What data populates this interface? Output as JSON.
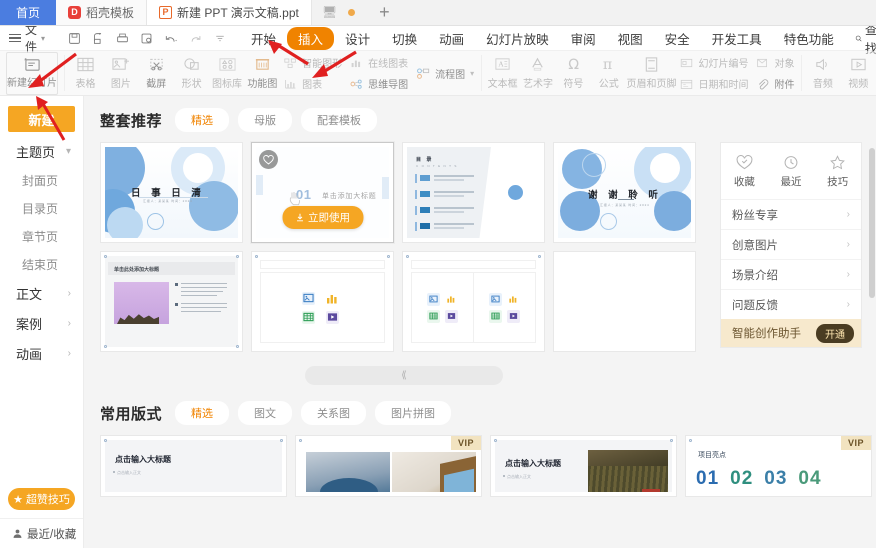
{
  "tabbar": {
    "home_label": "首页",
    "tabs": [
      {
        "label": "稻壳模板",
        "icon": "dock-icon",
        "active": false
      },
      {
        "label": "新建 PPT 演示文稿.ppt",
        "icon": "ppt-file-icon",
        "active": true
      }
    ],
    "monitor_icon": "monitor-icon",
    "record_icon": "record-dot-icon",
    "plus_label": "+"
  },
  "menubar": {
    "file_label": "文件",
    "quick_icons": [
      "save-icon",
      "print-preview-icon",
      "print-icon",
      "format-painter-icon",
      "undo-icon",
      "redo-icon",
      "customize-icon"
    ],
    "items": [
      {
        "label": "开始",
        "active": false
      },
      {
        "label": "插入",
        "active": true
      },
      {
        "label": "设计",
        "active": false
      },
      {
        "label": "切换",
        "active": false
      },
      {
        "label": "动画",
        "active": false
      },
      {
        "label": "幻灯片放映",
        "active": false
      },
      {
        "label": "审阅",
        "active": false
      },
      {
        "label": "视图",
        "active": false
      },
      {
        "label": "安全",
        "active": false
      },
      {
        "label": "开发工具",
        "active": false
      },
      {
        "label": "特色功能",
        "active": false
      }
    ],
    "find_label": "查找",
    "find_icon": "search-icon"
  },
  "ribbon": {
    "new_slide_label": "新建幻灯片",
    "items": [
      {
        "label": "表格",
        "icon": "table-icon"
      },
      {
        "label": "图片",
        "icon": "picture-icon"
      },
      {
        "label": "截屏",
        "icon": "screenshot-icon"
      },
      {
        "label": "形状",
        "icon": "shape-icon"
      },
      {
        "label": "图标库",
        "icon": "icon-library-icon"
      },
      {
        "label": "功能图",
        "icon": "function-chart-icon"
      }
    ],
    "stacked": [
      {
        "top": "智能图形",
        "top_icon": "smartart-icon",
        "bottom": "图表",
        "bottom_icon": "chart-icon"
      },
      {
        "top": "在线图表",
        "top_icon": "online-chart-icon",
        "bottom": "思维导图",
        "bottom_icon": "mindmap-icon"
      },
      {
        "top": "流程图",
        "top_icon": "flowchart-icon",
        "bottom": "",
        "bottom_icon": ""
      }
    ],
    "items2": [
      {
        "label": "文本框",
        "icon": "textbox-icon"
      },
      {
        "label": "艺术字",
        "icon": "wordart-icon"
      },
      {
        "label": "符号",
        "icon": "symbol-icon"
      },
      {
        "label": "公式",
        "icon": "formula-icon"
      },
      {
        "label": "页眉和页脚",
        "icon": "header-footer-icon"
      }
    ],
    "stacked2": [
      {
        "top": "幻灯片编号",
        "top_icon": "slide-number-icon",
        "bottom": "日期和时间",
        "bottom_icon": "datetime-icon"
      },
      {
        "top": "对象",
        "top_icon": "object-icon",
        "bottom": "附件",
        "bottom_icon": "attachment-icon"
      }
    ],
    "items3": [
      {
        "label": "音频",
        "icon": "audio-icon"
      },
      {
        "label": "视频",
        "icon": "video-icon"
      }
    ]
  },
  "sidebar": {
    "new_label": "新建",
    "groups": [
      {
        "label": "主题页",
        "expanded": true,
        "children": [
          "封面页",
          "目录页",
          "章节页",
          "结束页"
        ]
      },
      {
        "label": "正文",
        "expanded": false,
        "children": []
      },
      {
        "label": "案例",
        "expanded": false,
        "children": []
      },
      {
        "label": "动画",
        "expanded": false,
        "children": []
      }
    ],
    "tips_label": "超赞技巧",
    "tips_icon": "star-icon",
    "footer_label": "最近/收藏",
    "footer_icon": "user-icon"
  },
  "main": {
    "section1": {
      "title": "整套推荐",
      "tabs": [
        {
          "label": "精选",
          "active": true
        },
        {
          "label": "母版",
          "active": false
        },
        {
          "label": "配套模板",
          "active": false
        }
      ],
      "cards": [
        {
          "name": "cover-template",
          "title": "日 事 日 清",
          "subtitle": "汇报人：某某某  时间：2024"
        },
        {
          "name": "hovered-template",
          "hover": true,
          "number": "01",
          "heading": "单击添加大标题",
          "use_label": "立即使用",
          "fav_icon": "heart-icon",
          "use_icon": "download-icon"
        },
        {
          "name": "contents-template",
          "title": "目 录",
          "subtitle": "C O N T E N T S"
        },
        {
          "name": "thanks-template",
          "title": "谢 谢 聆 听",
          "subtitle": "汇报人：某某某  时间：2024"
        },
        {
          "name": "image-text-template",
          "title": "单击此处添加大标题"
        },
        {
          "name": "blank-placeholder-template",
          "placeholders": [
            "picture-icon",
            "chart-icon",
            "table-icon",
            "video-icon"
          ]
        },
        {
          "name": "two-column-placeholder-template",
          "placeholders": [
            "picture-icon",
            "chart-icon",
            "table-icon",
            "video-icon"
          ]
        },
        {
          "name": "blank-template"
        }
      ],
      "expand_icon": "chevron-double-down-icon"
    },
    "section2": {
      "title": "常用版式",
      "tabs": [
        {
          "label": "精选",
          "active": true
        },
        {
          "label": "图文",
          "active": false
        },
        {
          "label": "关系图",
          "active": false
        },
        {
          "label": "图片拼图",
          "active": false
        }
      ],
      "cards": [
        {
          "name": "layout-title-body",
          "title": "点击输入大标题",
          "subtitle": "点击输入正文",
          "vip": false
        },
        {
          "name": "layout-two-photos",
          "vip": true,
          "vip_label": "VIP"
        },
        {
          "name": "layout-text-photo",
          "title": "点击输入大标题",
          "subtitle": "点击输入正文",
          "vip": false
        },
        {
          "name": "layout-numbers",
          "title": "项目亮点",
          "numbers": [
            "01",
            "02",
            "03",
            "04"
          ],
          "vip": true,
          "vip_label": "VIP"
        }
      ]
    }
  },
  "rpanel": {
    "icons": [
      {
        "label": "收藏",
        "icon": "heart-check-icon"
      },
      {
        "label": "最近",
        "icon": "clock-icon"
      },
      {
        "label": "技巧",
        "icon": "star-outline-icon"
      }
    ],
    "rows": [
      {
        "label": "粉丝专享",
        "chevron": "chevron-right-icon"
      },
      {
        "label": "创意图片",
        "chevron": "chevron-right-icon"
      },
      {
        "label": "场景介绍",
        "chevron": "chevron-right-icon"
      },
      {
        "label": "问题反馈",
        "chevron": "chevron-right-icon"
      }
    ],
    "ai_label": "智能创作助手",
    "ai_button": "开通"
  },
  "colors": {
    "accent_orange": "#f08300",
    "brand_blue": "#4b7de0",
    "warm_gold": "#f5a623",
    "slide_blue": "#9dc3e6",
    "vip_bg": "#f2e3c0"
  }
}
